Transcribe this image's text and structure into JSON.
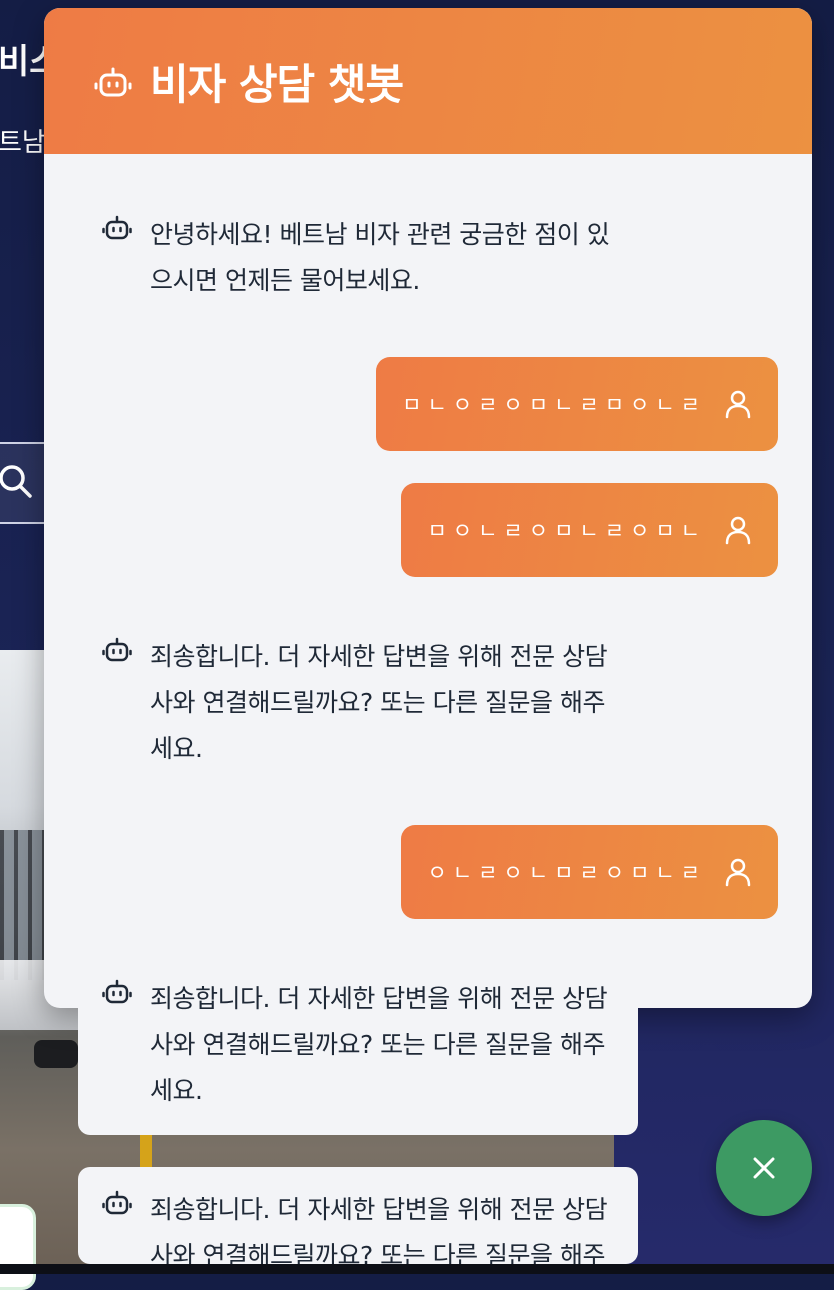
{
  "background": {
    "title_fragment": "비스",
    "subtitle_fragment": "트남"
  },
  "chat": {
    "title": "비자 상담 챗봇",
    "messages": [
      {
        "role": "bot",
        "text": "안녕하세요! 베트남 비자 관련 궁금한 점이 있으시면 언제든 물어보세요."
      },
      {
        "role": "user",
        "text": "ㅁㄴㅇㄹㅇㅁㄴㄹㅁㅇㄴㄹ"
      },
      {
        "role": "user",
        "text": "ㅁㅇㄴㄹㅇㅁㄴㄹㅇㅁㄴ"
      },
      {
        "role": "bot",
        "text": "죄송합니다. 더 자세한 답변을 위해 전문 상담사와 연결해드릴까요? 또는 다른 질문을 해주세요."
      },
      {
        "role": "user",
        "text": "ㅇㄴㄹㅇㄴㅁㄹㅇㅁㄴㄹ"
      },
      {
        "role": "bot",
        "text": "죄송합니다. 더 자세한 답변을 위해 전문 상담사와 연결해드릴까요? 또는 다른 질문을 해주세요."
      },
      {
        "role": "bot",
        "text": "죄송합니다. 더 자세한 답변을 위해 전문 상담사와 연결해드릴까요? 또는 다른 질문을 해주세요."
      }
    ]
  },
  "icons": {
    "header": "robot-icon",
    "bot": "robot-icon",
    "user": "user-icon",
    "close": "close-icon",
    "search": "search-icon"
  },
  "colors": {
    "header_gradient_start": "#ee7b45",
    "header_gradient_end": "#ec9141",
    "close_button": "#3d9a63",
    "panel_background": "#f3f4f7"
  }
}
